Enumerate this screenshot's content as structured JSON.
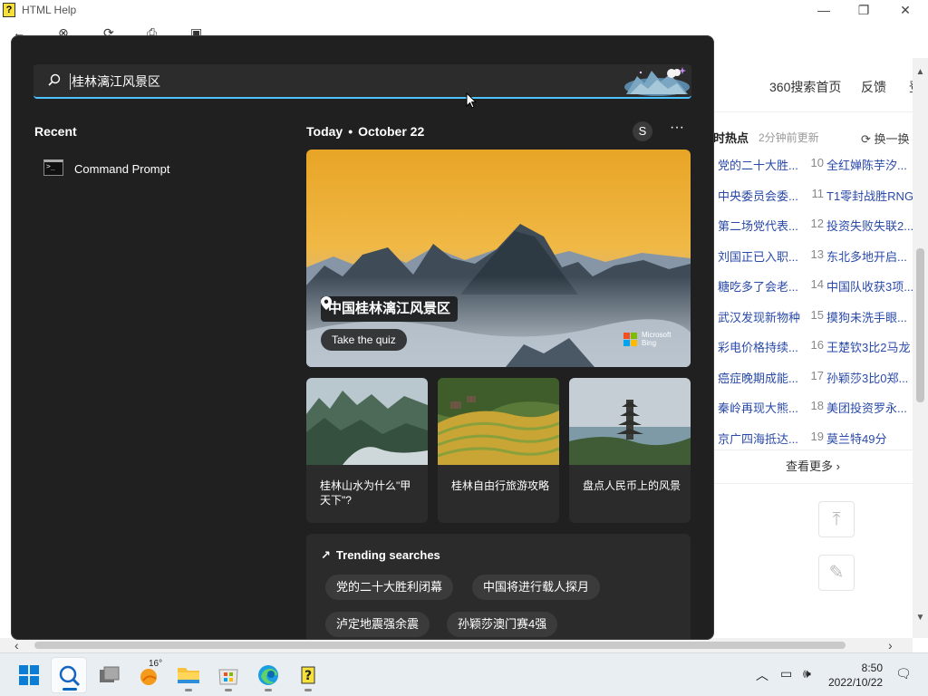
{
  "app": {
    "title": "HTML Help"
  },
  "web": {
    "header_links": [
      "360搜索首页",
      "反馈",
      "登"
    ],
    "hot": {
      "title": "时热点",
      "subtitle": "2分钟前更新",
      "refresh_label": "换一换",
      "rows": [
        {
          "a": "党的二十大胜...",
          "n": "10",
          "b": "全红婵陈芋汐..."
        },
        {
          "a": "中央委员会委...",
          "n": "11",
          "b": "T1零封战胜RNG"
        },
        {
          "a": "第二场党代表...",
          "n": "12",
          "b": "投资失败失联2..."
        },
        {
          "a": "刘国正已入职...",
          "n": "13",
          "b": "东北多地开启..."
        },
        {
          "a": "糖吃多了会老...",
          "n": "14",
          "b": "中国队收获3项..."
        },
        {
          "a": "武汉发现新物种",
          "n": "15",
          "b": "摸狗未洗手眼..."
        },
        {
          "a": "彩电价格持续...",
          "n": "16",
          "b": "王楚钦3比2马龙"
        },
        {
          "a": "癌症晚期成能...",
          "n": "17",
          "b": "孙颖莎3比0郑..."
        },
        {
          "a": "秦岭再现大熊...",
          "n": "18",
          "b": "美团投资罗永..."
        },
        {
          "a": "京广四海抵达...",
          "n": "19",
          "b": "莫兰特49分"
        }
      ],
      "more_label": "查看更多"
    }
  },
  "search": {
    "query": "桂林漓江风景区",
    "recent_label": "Recent",
    "recent_items": [
      {
        "label": "Command Prompt",
        "icon": "command-prompt-icon"
      }
    ],
    "today_label": "Today",
    "date_label": "October 22",
    "avatar_initial": "S",
    "more_label": "···",
    "hero": {
      "title": "中国桂林漓江风景区",
      "button": "Take the quiz",
      "brand_line1": "Microsoft",
      "brand_line2": "Bing"
    },
    "cards": [
      {
        "title": "桂林山水为什么\"甲天下\"?"
      },
      {
        "title": "桂林自由行旅游攻略"
      },
      {
        "title": "盘点人民币上的风景"
      }
    ],
    "trending": {
      "title": "Trending searches",
      "chips": [
        "党的二十大胜利闭幕",
        "中国将进行载人探月",
        "泸定地震强余震",
        "孙颖莎澳门赛4强"
      ]
    }
  },
  "taskbar": {
    "weather_temp": "16°",
    "time": "8:50",
    "date": "2022/10/22"
  },
  "colors": {
    "accent": "#4cc2ff",
    "flyout_bg": "#202020",
    "card_bg": "#2b2b2b",
    "link_blue": "#2a4aa8"
  }
}
